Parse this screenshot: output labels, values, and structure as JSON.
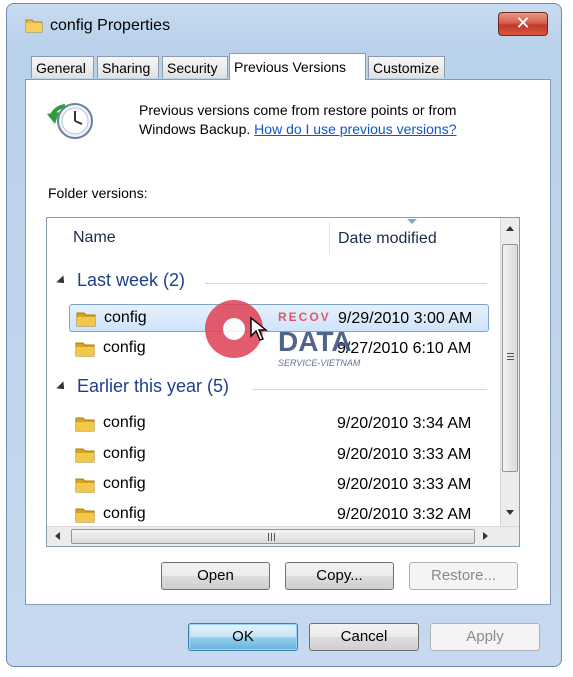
{
  "window": {
    "title": "config Properties"
  },
  "tabs": [
    {
      "label": "General"
    },
    {
      "label": "Sharing"
    },
    {
      "label": "Security"
    },
    {
      "label": "Previous Versions"
    },
    {
      "label": "Customize"
    }
  ],
  "active_tab": "Previous Versions",
  "info": {
    "text": "Previous versions come from restore points or from Windows Backup.",
    "link": "How do I use previous versions?"
  },
  "folder_versions_label": "Folder versions:",
  "columns": {
    "name": "Name",
    "date_modified": "Date modified"
  },
  "groups": [
    {
      "label": "Last week (2)",
      "items": [
        {
          "name": "config",
          "date": "9/29/2010 3:00 AM",
          "selected": true
        },
        {
          "name": "config",
          "date": "9/27/2010 6:10 AM",
          "selected": false
        }
      ]
    },
    {
      "label": "Earlier this year (5)",
      "items": [
        {
          "name": "config",
          "date": "9/20/2010 3:34 AM",
          "selected": false
        },
        {
          "name": "config",
          "date": "9/20/2010 3:33 AM",
          "selected": false
        },
        {
          "name": "config",
          "date": "9/20/2010 3:33 AM",
          "selected": false
        },
        {
          "name": "config",
          "date": "9/20/2010 3:32 AM",
          "selected": false
        }
      ]
    }
  ],
  "version_buttons": {
    "open": "Open",
    "copy": "Copy...",
    "restore": "Restore..."
  },
  "dialog_buttons": {
    "ok": "OK",
    "cancel": "Cancel",
    "apply": "Apply"
  },
  "watermark": {
    "brand": "RECOV",
    "data": "DATA",
    "tagline": "SERVICE-VIETNAM"
  },
  "icons": {
    "title": "folder-icon",
    "close": "close-icon",
    "clock": "restore-clock-icon",
    "row": "folder-icon"
  },
  "colors": {
    "accent": "#1155cc",
    "group_header": "#1e3e8c",
    "close_button": "#c0392b",
    "watermark": "#e0465a"
  }
}
